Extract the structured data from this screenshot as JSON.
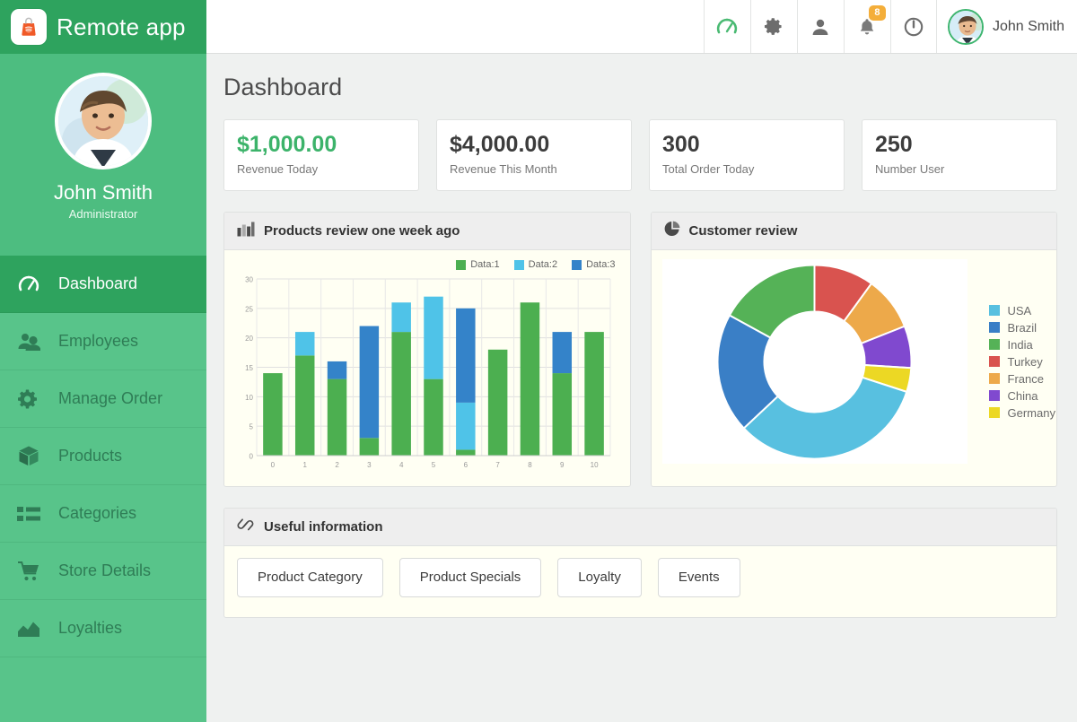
{
  "brand": {
    "name": "Remote app",
    "logo_icon": "shopping-bag-icon"
  },
  "topbar": {
    "icons": [
      {
        "name": "dashboard-gauge-icon",
        "label": "Dashboard"
      },
      {
        "name": "gear-icon",
        "label": "Settings"
      },
      {
        "name": "user-icon",
        "label": "Profile"
      },
      {
        "name": "bell-icon",
        "label": "Notifications",
        "badge": "8"
      },
      {
        "name": "power-icon",
        "label": "Logout"
      }
    ],
    "user_name": "John Smith",
    "notification_count": "8"
  },
  "sidebar": {
    "profile": {
      "name": "John Smith",
      "role": "Administrator"
    },
    "items": [
      {
        "label": "Dashboard",
        "icon": "gauge-icon",
        "active": true
      },
      {
        "label": "Employees",
        "icon": "users-icon",
        "active": false
      },
      {
        "label": "Manage Order",
        "icon": "gear-icon",
        "active": false
      },
      {
        "label": "Products",
        "icon": "box-icon",
        "active": false
      },
      {
        "label": "Categories",
        "icon": "list-icon",
        "active": false
      },
      {
        "label": "Store Details",
        "icon": "cart-icon",
        "active": false
      },
      {
        "label": "Loyalties",
        "icon": "area-chart-icon",
        "active": false
      }
    ]
  },
  "main": {
    "page_title": "Dashboard",
    "stats": [
      {
        "value": "$1,000.00",
        "label": "Revenue Today",
        "accent": "#3cb36a"
      },
      {
        "value": "$4,000.00",
        "label": "Revenue This Month",
        "accent": "#3c3c3c"
      },
      {
        "value": "300",
        "label": "Total Order Today",
        "accent": "#3c3c3c"
      },
      {
        "value": "250",
        "label": "Number User",
        "accent": "#3c3c3c"
      }
    ],
    "bar_panel_title": "Products review one week ago",
    "bar_panel_icon": "bar-chart-icon",
    "donut_panel_title": "Customer review",
    "donut_panel_icon": "pie-chart-icon",
    "info_panel_title": "Useful information",
    "info_panel_icon": "link-icon",
    "info_buttons": [
      "Product Category",
      "Product Specials",
      "Loyalty",
      "Events"
    ]
  },
  "chart_data": [
    {
      "type": "bar",
      "id": "products-review-bar-chart",
      "title": "Products review one week ago",
      "stacked": true,
      "xlabel": "",
      "ylabel": "",
      "ylim": [
        0,
        30
      ],
      "yticks": [
        0,
        5,
        10,
        15,
        20,
        25,
        30
      ],
      "grid": true,
      "legend_position": "top-right",
      "categories": [
        "0",
        "1",
        "2",
        "3",
        "4",
        "5",
        "6",
        "7",
        "8",
        "9",
        "10"
      ],
      "series": [
        {
          "name": "Data:1",
          "color": "#4caf50",
          "values": [
            14,
            17,
            13,
            3,
            21,
            13,
            1,
            18,
            26,
            14,
            21
          ]
        },
        {
          "name": "Data:2",
          "color": "#4fc3e8",
          "values": [
            0,
            4,
            0,
            0,
            5,
            14,
            8,
            0,
            0,
            0,
            0
          ]
        },
        {
          "name": "Data:3",
          "color": "#3483c9",
          "values": [
            0,
            0,
            3,
            19,
            0,
            0,
            16,
            0,
            0,
            7,
            0
          ]
        }
      ],
      "totals": [
        14,
        21,
        16,
        22,
        26,
        27,
        25,
        18,
        26,
        21,
        21
      ]
    },
    {
      "type": "pie",
      "id": "customer-review-donut-chart",
      "title": "Customer review",
      "donut": true,
      "legend_position": "right",
      "labels": [
        "USA",
        "Brazil",
        "India",
        "Turkey",
        "France",
        "China",
        "Germany"
      ],
      "colors": [
        "#58c0e0",
        "#3a7fc6",
        "#55b257",
        "#d9534f",
        "#edA94a",
        "#8049cf",
        "#ecd824"
      ],
      "values": [
        33,
        20,
        17,
        10,
        9,
        7,
        4
      ],
      "units": "percent"
    }
  ]
}
